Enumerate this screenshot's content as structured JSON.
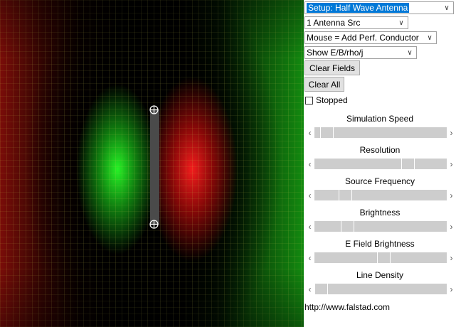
{
  "controls": {
    "setup": "Setup: Half Wave Antenna",
    "source": "1 Antenna Src",
    "mouse": "Mouse = Add Perf. Conductor",
    "show": "Show E/B/rho/j",
    "clear_fields": "Clear Fields",
    "clear_all": "Clear All",
    "stopped": "Stopped"
  },
  "sliders": [
    {
      "label": "Simulation Speed",
      "level": 0.05
    },
    {
      "label": "Resolution",
      "level": 0.72
    },
    {
      "label": "Source Frequency",
      "level": 0.2
    },
    {
      "label": "Brightness",
      "level": 0.22
    },
    {
      "label": "E Field Brightness",
      "level": 0.52
    },
    {
      "label": "Line Density",
      "level": 0.0
    }
  ],
  "footer": {
    "url": "http://www.falstad.com"
  },
  "colors": {
    "positive": "#ff2020",
    "negative": "#20ff20",
    "conductor": "#4a4a4a",
    "accent": "#0078d7"
  }
}
